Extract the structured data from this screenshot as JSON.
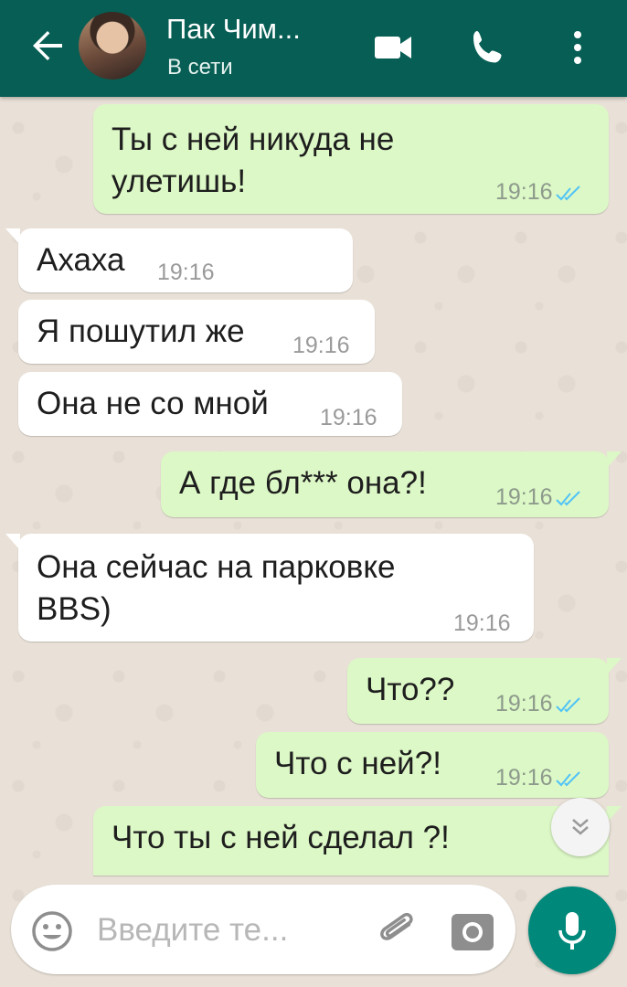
{
  "header": {
    "contact_name": "Пак Чим...",
    "status": "В сети"
  },
  "messages": [
    {
      "dir": "out",
      "lines": [
        "Ты с ней никуда не",
        "улетишь!"
      ],
      "time": "19:16",
      "read": true
    },
    {
      "dir": "in",
      "lines": [
        "Ахаха"
      ],
      "time": "19:16"
    },
    {
      "dir": "in",
      "lines": [
        "Я пошутил же"
      ],
      "time": "19:16"
    },
    {
      "dir": "in",
      "lines": [
        "Она не со мной"
      ],
      "time": "19:16"
    },
    {
      "dir": "out",
      "lines": [
        "А где бл*** она?!"
      ],
      "time": "19:16",
      "read": true
    },
    {
      "dir": "in",
      "lines": [
        "Она сейчас на парковке",
        "BBS)"
      ],
      "time": "19:16"
    },
    {
      "dir": "out",
      "lines": [
        "Что??"
      ],
      "time": "19:16",
      "read": true
    },
    {
      "dir": "out",
      "lines": [
        "Что с ней?!"
      ],
      "time": "19:16",
      "read": true
    },
    {
      "dir": "out",
      "lines": [
        "Что ты с ней сделал ?!"
      ],
      "time": "",
      "read": false
    }
  ],
  "input": {
    "placeholder": "Введите те..."
  },
  "colors": {
    "header": "#075e54",
    "outgoing": "#dcf8c6",
    "incoming": "#ffffff",
    "read_ticks": "#4fc3f7",
    "mic_button": "#00897b"
  },
  "icons": [
    "back-arrow-icon",
    "video-call-icon",
    "phone-icon",
    "more-vert-icon",
    "double-check-icon",
    "chevron-double-down-icon",
    "emoji-icon",
    "paperclip-icon",
    "camera-icon",
    "mic-icon"
  ]
}
